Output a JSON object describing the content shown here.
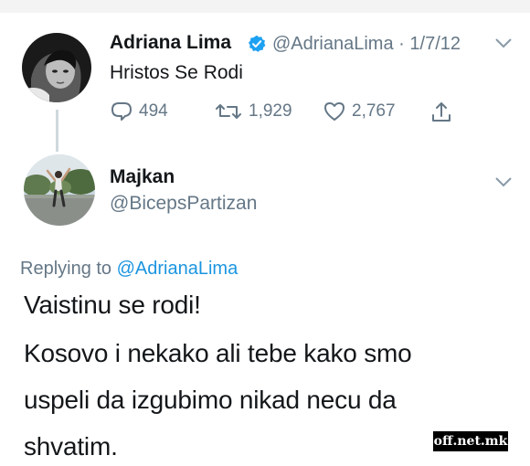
{
  "tweet": {
    "author_name": "Adriana Lima",
    "author_handle": "@AdrianaLima",
    "time_sep": "·",
    "date": "1/7/12",
    "text": "Hristos Se Rodi",
    "actions": {
      "reply_count": "494",
      "retweet_count": "1,929",
      "like_count": "2,767"
    }
  },
  "reply": {
    "author_name": "Majkan",
    "author_handle": "@BicepsPartizan",
    "replying_prefix": "Replying to",
    "replying_to": "@AdrianaLima",
    "lines": [
      "Vaistinu se rodi!",
      "Kosovo i nekako ali tebe kako smo",
      "uspeli da izgubimo nikad necu da",
      "shvatim."
    ]
  },
  "watermark": "off.net.mk",
  "icons": {
    "verified": "verified-badge-icon",
    "chevron": "chevron-down-icon",
    "reply": "reply-bubble-icon",
    "retweet": "retweet-icon",
    "like": "heart-icon",
    "share": "share-icon"
  },
  "colors": {
    "text": "#14171a",
    "secondary": "#657786",
    "link": "#1b95e0",
    "verified": "#1da1f2"
  }
}
